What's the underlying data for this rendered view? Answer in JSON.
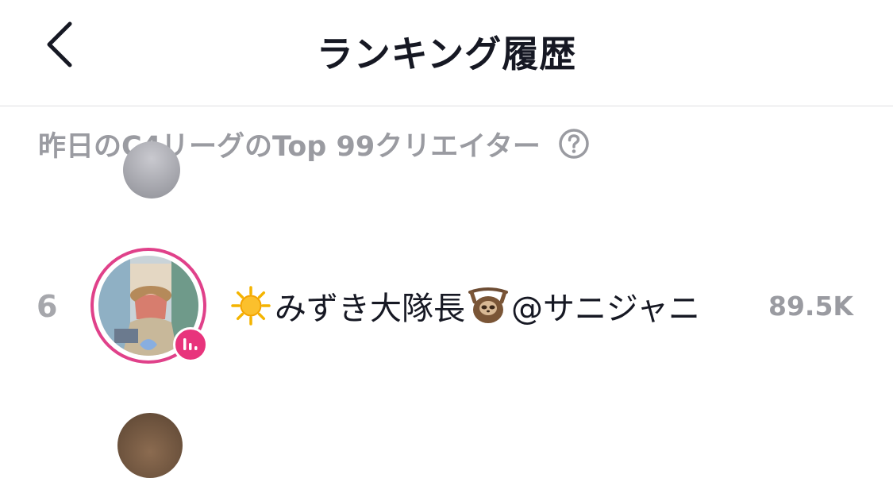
{
  "header": {
    "title": "ランキング履歴",
    "back_icon": "chevron-left-icon"
  },
  "subheader": {
    "text": "昨日のC4リーグのTop 99クリエイター",
    "help_icon": "question-circle-icon"
  },
  "ranking": [
    {
      "rank": "6",
      "name_main": "みずき大隊長",
      "name_suffix": "@サニジャニ",
      "score": "89.5K",
      "leading_emoji_icon": "sun-icon",
      "inline_emoji_icon": "sloth-icon",
      "live_badge": true
    }
  ],
  "colors": {
    "accent": "#e0418a",
    "live_badge": "#e8347c",
    "muted_text": "#9a9ba1",
    "divider": "#dedfe2"
  }
}
